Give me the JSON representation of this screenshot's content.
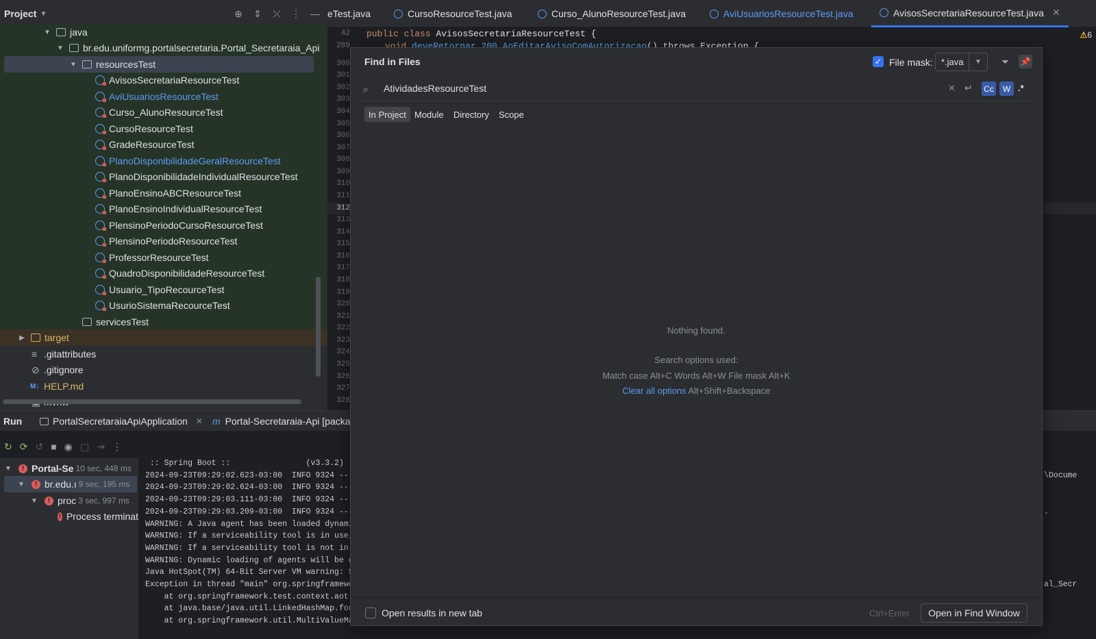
{
  "project": {
    "title": "Project",
    "tree": {
      "java": "java",
      "package": "br.edu.uniformg.portalsecretaria.Portal_Secretaraia_Api",
      "resourcesTest": "resourcesTest",
      "files": [
        "AvisosSecretariaResourceTest",
        "AviUsuariosResourceTest",
        "Curso_AlunoResourceTest",
        "CursoResourceTest",
        "GradeResourceTest",
        "PlanoDisponibilidadeGeralResourceTest",
        "PlanoDisponibilidadeIndividualResourceTest",
        "PlanoEnsinoABCResourceTest",
        "PlanoEnsinoIndividualResourceTest",
        "PlensinoPeriodoCursoResourceTest",
        "PlensinoPeriodoResourceTest",
        "ProfessorResourceTest",
        "QuadroDisponibilidadeResourceTest",
        "Usuario_TipoRecourceTest",
        "UsurioSistemaRecourceTest"
      ],
      "servicesTest": "servicesTest",
      "target": "target",
      "gitattributes": ".gitattributes",
      "gitignore": ".gitignore",
      "help": "HELP.md",
      "help_badge": "M↓",
      "mvnw": "mvnw"
    }
  },
  "editor": {
    "tabs": [
      "eTest.java",
      "CursoResourceTest.java",
      "Curso_AlunoResourceTest.java",
      "AviUsuariosResourceTest.java",
      "AvisosSecretariaResourceTest.java"
    ],
    "warning_count": "6",
    "line_numbers": [
      "42",
      "289",
      "300",
      "301",
      "302",
      "303",
      "304",
      "305",
      "306",
      "307",
      "308",
      "309",
      "310",
      "311",
      "312",
      "313",
      "314",
      "315",
      "316",
      "317",
      "318",
      "319",
      "320",
      "321",
      "322",
      "323",
      "324",
      "325",
      "326",
      "327",
      "328"
    ],
    "code_kw1": "public class",
    "code_class": "AvisosSecretariaResourceTest {",
    "code_kw2": "void",
    "code_method": "deveRetornar_200_AoEditarAvisoComAutorizacao",
    "code_rest": "() throws Exception {"
  },
  "run": {
    "title": "Run",
    "tabs": [
      "PortalSecretaraiaApiApplication",
      "Portal-Secretaraia-Api [packag"
    ],
    "tree": [
      {
        "label": "Portal-Se",
        "duration": "10 sec, 448 ms"
      },
      {
        "label": "br.edu.ı",
        "duration": "9 sec, 195 ms"
      },
      {
        "label": "proc",
        "duration": "3 sec, 997 ms"
      },
      {
        "label": "Process terminat",
        "duration": ""
      }
    ],
    "console": [
      " :: Spring Boot ::                (v3.3.2)",
      "2024-09-23T09:29:02.623-03:00  INFO 9324 ---",
      "2024-09-23T09:29:02.624-03:00  INFO 9324 ---",
      "2024-09-23T09:29:03.111-03:00  INFO 9324 ---",
      "2024-09-23T09:29:03.209-03:00  INFO 9324 ---",
      "WARNING: A Java agent has been loaded dynami",
      "WARNING: If a serviceability tool is in use,",
      "WARNING: If a serviceability tool is not in",
      "WARNING: Dynamic loading of agents will be d",
      "Java HotSpot(TM) 64-Bit Server VM warning: S",
      "Exception in thread \"main\" org.springframewo",
      "    at org.springframework.test.context.aot.",
      "    at java.base/java.util.LinkedHashMap.for",
      "    at org.springframework.util.MultiValueMa"
    ],
    "right_fragments": [
      "\\Docume",
      ".",
      "al_Secr"
    ]
  },
  "dialog": {
    "title": "Find in Files",
    "file_mask_label": "File mask:",
    "file_mask_value": "*.java",
    "search_value": "AtividadesResourceTest",
    "match_case": "Cc",
    "words": "W",
    "regex": ".*",
    "scopes": [
      "In Project",
      "Module",
      "Directory",
      "Scope"
    ],
    "nothing_found": "Nothing found.",
    "options_used_label": "Search options used:",
    "options_used": "Match case Alt+C  Words Alt+W  File mask Alt+K",
    "clear_all": "Clear all options",
    "clear_all_shortcut": "Alt+Shift+Backspace",
    "open_new_tab": "Open results in new tab",
    "shortcut_hint": "Ctrl+Enter",
    "open_button": "Open in Find Window"
  }
}
